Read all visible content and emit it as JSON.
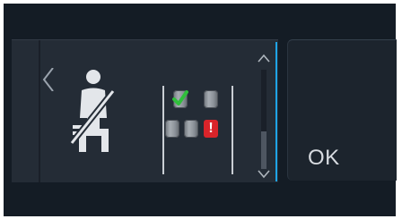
{
  "seatbelt_panel": {
    "icon": "seatbelt-unfastened-icon",
    "seats": [
      {
        "row": 1,
        "position": "left",
        "status": "fastened"
      },
      {
        "row": 1,
        "position": "right",
        "status": "unknown"
      },
      {
        "row": 2,
        "position": "left",
        "status": "unknown"
      },
      {
        "row": 2,
        "position": "center",
        "status": "unknown"
      },
      {
        "row": 2,
        "position": "right",
        "status": "warning",
        "symbol": "!"
      }
    ]
  },
  "scrollbar": {
    "up_icon": "chevron-up-icon",
    "down_icon": "chevron-down-icon"
  },
  "ok_button": {
    "label": "OK"
  },
  "colors": {
    "screen_bg": "#141c25",
    "panel_bg": "#242c36",
    "accent": "#1fa4e6",
    "check_green": "#2fbf3b",
    "warning_red": "#d9242a"
  }
}
